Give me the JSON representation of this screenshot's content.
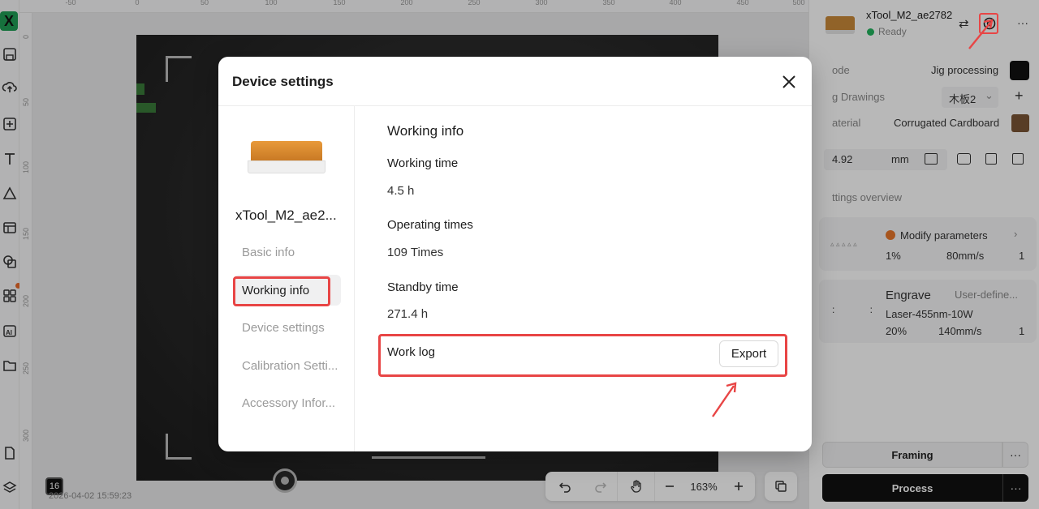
{
  "left_toolbar": {
    "logo": "X",
    "icons": [
      "save-icon",
      "cloud-upload-icon",
      "add-icon",
      "text-icon",
      "shape-icon",
      "layout-icon",
      "copy-shape-icon",
      "apps-icon",
      "ai-icon",
      "folder-icon",
      "file-icon",
      "layers-icon"
    ]
  },
  "ruler": {
    "top": [
      "-50",
      "0",
      "50",
      "100",
      "150",
      "200",
      "250",
      "300",
      "350",
      "400",
      "450",
      "500"
    ],
    "left": [
      "0",
      "50",
      "100",
      "150",
      "200",
      "250",
      "300"
    ]
  },
  "canvas": {
    "timestamp": "2026-04-02 15:59:23",
    "layer_badge": "16",
    "zoom": "163%"
  },
  "right_panel": {
    "device_name": "xTool_M2_ae2782",
    "status": "Ready",
    "mode_label": "ode",
    "mode_value": "Jig processing",
    "drawings_label": "g Drawings",
    "drawings_value": "木板2",
    "material_label": "aterial",
    "material_value": "Corrugated Cardboard",
    "thickness_value": "4.92",
    "thickness_unit": "mm",
    "settings_overview": "ttings overview",
    "card1": {
      "title": "Modify parameters",
      "power": "1%",
      "speed": "80mm/s",
      "passes": "1"
    },
    "card2": {
      "title": "Engrave",
      "type": "User-define...",
      "laser": "Laser-455nm-10W",
      "power": "20%",
      "speed": "140mm/s",
      "passes": "1"
    },
    "framing_label": "Framing",
    "process_label": "Process",
    "more_label": "···"
  },
  "modal": {
    "title": "Device settings",
    "device_name": "xTool_M2_ae2...",
    "nav": [
      "Basic info",
      "Working info",
      "Device settings",
      "Calibration Setti...",
      "Accessory Infor..."
    ],
    "section_title": "Working info",
    "working_time_label": "Working time",
    "working_time_value": "4.5 h",
    "operating_times_label": "Operating times",
    "operating_times_value": "109 Times",
    "standby_time_label": "Standby time",
    "standby_time_value": "271.4 h",
    "work_log_label": "Work log",
    "export_label": "Export"
  },
  "colors": {
    "highlight": "#e84545",
    "status_ok": "#22b35e",
    "warning": "#e8772a"
  }
}
